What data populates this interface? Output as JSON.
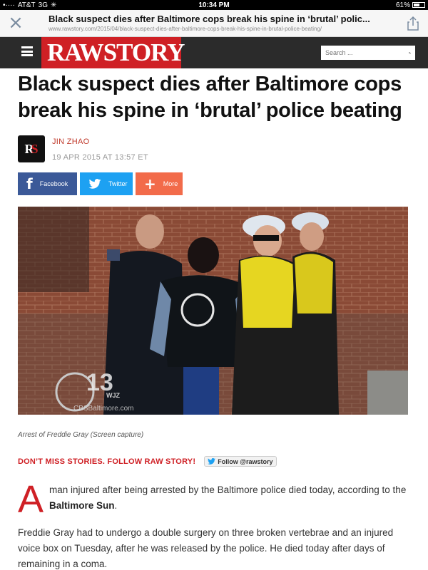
{
  "status": {
    "carrier": "AT&T",
    "network": "3G",
    "time": "10:34 PM",
    "battery": "61%",
    "battery_level": 0.61
  },
  "browser": {
    "page_title": "Black suspect dies after Baltimore cops break his spine in ‘brutal’ polic...",
    "url": "www.rawstory.com/2015/04/black-suspect-dies-after-baltimore-cops-break-his-spine-in-brutal-police-beating/"
  },
  "site": {
    "logo_raw": "RAW",
    "logo_story": "STORY",
    "search_placeholder": "Search ..."
  },
  "article": {
    "headline": "Black suspect dies after Baltimore cops break his spine in ‘brutal’ police beating",
    "avatar_r": "R",
    "avatar_s": "S",
    "author": "JIN ZHAO",
    "date": "19 APR 2015 AT 13:57 ET",
    "share": {
      "facebook": "Facebook",
      "twitter": "Twitter",
      "more": "More"
    },
    "photo_watermark": "13",
    "photo_watermark_sub": "WJZ",
    "photo_site": "CBSBaltimore.com",
    "caption": "Arrest of Freddie Gray (Screen capture)",
    "follow_text": "DON’T MISS STORIES. FOLLOW RAW STORY!",
    "follow_button": "Follow @rawstory",
    "dropcap": "A",
    "para1_text": "man injured after being arrested by the Baltimore police died today, according to the ",
    "para1_bold": "Baltimore Sun",
    "para1_end": ".",
    "para2": "Freddie Gray had to undergo a double surgery on three broken vertebrae and an injured voice box on Tuesday, after he was released by the police. He died today after days of remaining in a coma."
  },
  "colors": {
    "brand_red": "#cf2025",
    "header_dark": "#2b2b2b",
    "facebook": "#3b5998",
    "twitter": "#1da1f2",
    "more": "#f26b4a"
  }
}
